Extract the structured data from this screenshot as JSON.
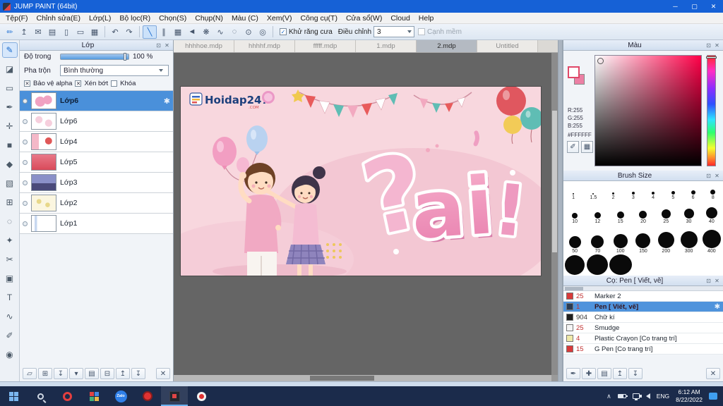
{
  "icons": {
    "gear": "✱",
    "close": "✕",
    "popout": "⊡",
    "check": "✓",
    "x": "✕",
    "undo": "↶",
    "redo": "↷",
    "chevron_up": "∧"
  },
  "window": {
    "title": "JUMP PAINT (64bit)",
    "minimize": "─",
    "maximize": "▢",
    "close": "✕"
  },
  "menu": {
    "items": [
      "Tệp(F)",
      "Chỉnh sửa(E)",
      "Lớp(L)",
      "Bộ lọc(R)",
      "Chọn(S)",
      "Chụp(N)",
      "Màu (C)",
      "Xem(V)",
      "Công cụ(T)",
      "Cửa sổ(W)",
      "Cloud",
      "Help"
    ]
  },
  "toolbar": {
    "file_icons": [
      {
        "name": "brush-edit-icon",
        "glyph": "✏"
      },
      {
        "name": "export-icon",
        "glyph": "↥"
      },
      {
        "name": "comment-icon",
        "glyph": "✉"
      },
      {
        "name": "panel-icon",
        "glyph": "▤"
      },
      {
        "name": "page-icon",
        "glyph": "▯"
      },
      {
        "name": "pages-icon",
        "glyph": "▭"
      },
      {
        "name": "grid-icon",
        "glyph": "▦"
      }
    ],
    "shape_icons": [
      {
        "name": "line-snap-icon",
        "glyph": "╲"
      },
      {
        "name": "parallel-snap-icon",
        "glyph": "∥"
      },
      {
        "name": "grid-snap-icon",
        "glyph": "▦"
      },
      {
        "name": "vanishing-point-icon",
        "glyph": "◄"
      },
      {
        "name": "radial-snap-icon",
        "glyph": "❋"
      },
      {
        "name": "curve-snap-icon",
        "glyph": "∿"
      },
      {
        "name": "ellipse-snap-icon",
        "glyph": "◌"
      },
      {
        "name": "focus-snap-icon",
        "glyph": "⊙"
      },
      {
        "name": "snap-settings-icon",
        "glyph": "◎"
      }
    ],
    "antialias_label": "Khử răng cưa",
    "antialias_checked": true,
    "adjust_label": "Điều chỉnh",
    "adjust_value": "3",
    "soft_edge_label": "Cạnh mềm",
    "soft_edge_checked": false
  },
  "toolstrip": [
    {
      "name": "brush-tool",
      "glyph": "✎"
    },
    {
      "name": "eraser-tool",
      "glyph": "◪"
    },
    {
      "name": "select-rect-tool",
      "glyph": "▭"
    },
    {
      "name": "pen-tool",
      "glyph": "✒"
    },
    {
      "name": "move-tool",
      "glyph": "✛"
    },
    {
      "name": "fill-rect-tool",
      "glyph": "■"
    },
    {
      "name": "bucket-tool",
      "glyph": "◆"
    },
    {
      "name": "gradient-tool",
      "glyph": "▧"
    },
    {
      "name": "marquee-tool",
      "glyph": "⊞"
    },
    {
      "name": "lasso-tool",
      "glyph": "◌"
    },
    {
      "name": "magic-wand-tool",
      "glyph": "✦"
    },
    {
      "name": "scissors-tool",
      "glyph": "✂"
    },
    {
      "name": "stamp-tool",
      "glyph": "▣"
    },
    {
      "name": "text-tool",
      "glyph": "T"
    },
    {
      "name": "curve-tool",
      "glyph": "∿"
    },
    {
      "name": "eyedropper-tool",
      "glyph": "✐"
    },
    {
      "name": "hand-tool",
      "glyph": "◉"
    }
  ],
  "layers_panel": {
    "title": "Lớp",
    "opacity_label": "Độ trong",
    "opacity_value": "100 %",
    "blend_label": "Pha trộn",
    "blend_value": "Bình thường",
    "options": [
      {
        "label": "Bảo vệ alpha",
        "checked": true
      },
      {
        "label": "Xén bớt",
        "checked": true
      },
      {
        "label": "Khóa",
        "checked": false
      }
    ],
    "layers": [
      {
        "name": "Lớp6",
        "selected": true
      },
      {
        "name": "Lớp6"
      },
      {
        "name": "Lớp4"
      },
      {
        "name": "Lớp5"
      },
      {
        "name": "Lớp3"
      },
      {
        "name": "Lớp2"
      },
      {
        "name": "Lớp1"
      }
    ],
    "bottom_icons": [
      {
        "name": "new-layer-icon",
        "glyph": "▱"
      },
      {
        "name": "duplicate-layer-icon",
        "glyph": "⊞"
      },
      {
        "name": "merge-down-icon",
        "glyph": "↧"
      },
      {
        "name": "layer-menu-icon",
        "glyph": "▾"
      },
      {
        "name": "folder-icon",
        "glyph": "▤"
      },
      {
        "name": "merge-icon",
        "glyph": "⊟"
      },
      {
        "name": "move-up-icon",
        "glyph": "↥"
      },
      {
        "name": "move-down-icon",
        "glyph": "↧"
      },
      {
        "name": "delete-layer-icon",
        "glyph": "✕"
      }
    ]
  },
  "document_tabs": [
    "hhhhoe.mdp",
    "hhhhf.mdp",
    "fffff.mdp",
    "1.mdp",
    "2.mdp",
    "Untitled"
  ],
  "canvas_art": {
    "logo_text": "Hoidap247",
    "logo_sub": ".COM",
    "big_text": "ai",
    "question_mark": "?",
    "exclamation": "!"
  },
  "color_panel": {
    "title": "Màu",
    "r": "R:255",
    "g": "G:255",
    "b": "B:255",
    "hex": "#FFFFFF",
    "buttons": [
      {
        "name": "eyedropper-button",
        "glyph": "✐"
      },
      {
        "name": "palette-button",
        "glyph": "▦"
      }
    ]
  },
  "brush_size_panel": {
    "title": "Brush Size",
    "row1": [
      "1",
      "1.5",
      "2",
      "3",
      "4",
      "5",
      "6",
      "8"
    ],
    "row2": [
      "10",
      "12",
      "15",
      "20",
      "25",
      "30",
      "40"
    ],
    "row3": [
      "50",
      "70",
      "100",
      "150",
      "200",
      "300",
      "400"
    ]
  },
  "brush_panel": {
    "title": "Cọ: Pen [ Viết, vẽ]",
    "brushes": [
      {
        "num": "25",
        "name": "Marker 2"
      },
      {
        "num": "1",
        "name": "Pen [ Viết, vẽ]",
        "selected": true
      },
      {
        "num": "904",
        "name": "Chữ kí"
      },
      {
        "num": "25",
        "name": "Smudge"
      },
      {
        "num": "4",
        "name": "Plastic Crayon [Co trang trí]"
      },
      {
        "num": "15",
        "name": "G Pen [Co trang trí]"
      }
    ],
    "bottom_icons": [
      {
        "name": "edit-brush-icon",
        "glyph": "✒"
      },
      {
        "name": "add-brush-icon",
        "glyph": "✚"
      },
      {
        "name": "brush-folder-icon",
        "glyph": "▤"
      },
      {
        "name": "brush-up-icon",
        "glyph": "↥"
      },
      {
        "name": "brush-down-icon",
        "glyph": "↧"
      },
      {
        "name": "delete-brush-icon",
        "glyph": "✕"
      }
    ]
  },
  "taskbar": {
    "zalo_label": "Zalo",
    "lang": "ENG",
    "time": "6:12 AM",
    "date": "8/22/2022"
  },
  "colors": {
    "titlebar": "#1661d6",
    "accent": "#3e86d8",
    "selection": "#4a90da",
    "taskbar_bg": "#1b2b4b",
    "canvas_bg": "#656565",
    "art_pink": "#f8d7de",
    "art_text_pink": "#ee9dbd",
    "current_color": "#FFFFFF"
  }
}
